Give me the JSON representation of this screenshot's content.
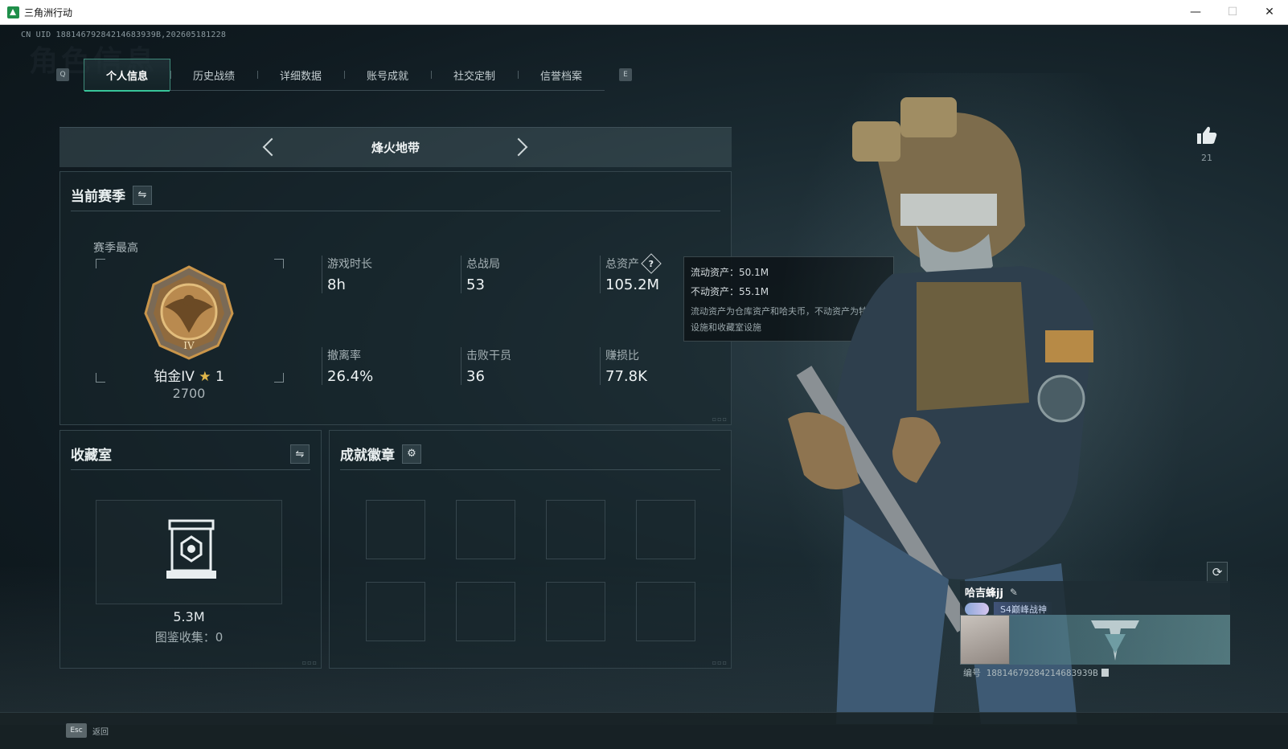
{
  "window": {
    "title": "三角洲行动",
    "controls": {
      "minimize": "—",
      "maximize": "☐",
      "close": "✕"
    }
  },
  "header": {
    "uid": "CN UID 18814679284214683939B,202605181228",
    "watermark": "角色信息"
  },
  "tabs": {
    "left_key": "Q",
    "right_key": "E",
    "items": [
      {
        "label": "个人信息",
        "active": true
      },
      {
        "label": "历史战绩",
        "active": false
      },
      {
        "label": "详细数据",
        "active": false
      },
      {
        "label": "账号成就",
        "active": false
      },
      {
        "label": "社交定制",
        "active": false
      },
      {
        "label": "信誉档案",
        "active": false
      }
    ]
  },
  "mode": {
    "label": "烽火地带"
  },
  "season": {
    "title": "当前赛季",
    "swap_icon": "⇋",
    "best_label": "赛季最高",
    "rank_name": "铂金IV",
    "rank_star_icon": "★",
    "rank_stars": "1",
    "rank_score": "2700",
    "stats": {
      "play_time": {
        "label": "游戏时长",
        "value": "8h"
      },
      "total_matches": {
        "label": "总战局",
        "value": "53"
      },
      "total_assets": {
        "label": "总资产",
        "value": "105.2M"
      },
      "extract_rate": {
        "label": "撤离率",
        "value": "26.4%"
      },
      "kills": {
        "label": "击败干员",
        "value": "36"
      },
      "profit_ratio": {
        "label": "赚损比",
        "value": "77.8K"
      }
    }
  },
  "tooltip": {
    "liquid": "流动资产：50.1M",
    "fixed": "不动资产：55.1M",
    "note": "流动资产为仓库资产和哈夫币，不动资产为特勤处设施和收藏室设施"
  },
  "collection": {
    "title": "收藏室",
    "swap_icon": "⇋",
    "value": "5.3M",
    "codex": "图鉴收集：0"
  },
  "badges": {
    "title": "成就徽章",
    "settings_icon": "⚙",
    "slots": 8
  },
  "profile": {
    "like_count": "21",
    "name": "哈吉蜂jj",
    "edit_icon": "✎",
    "title_text": "S4巅峰战神",
    "id_text": "编号 18814679284214683939B",
    "refresh_icon": "⟳"
  },
  "footer": {
    "esc_key": "Esc",
    "esc_label": "返回"
  },
  "colors": {
    "accent": "#38c59a",
    "rank_gold": "#c9954a",
    "star": "#e0b64a"
  }
}
